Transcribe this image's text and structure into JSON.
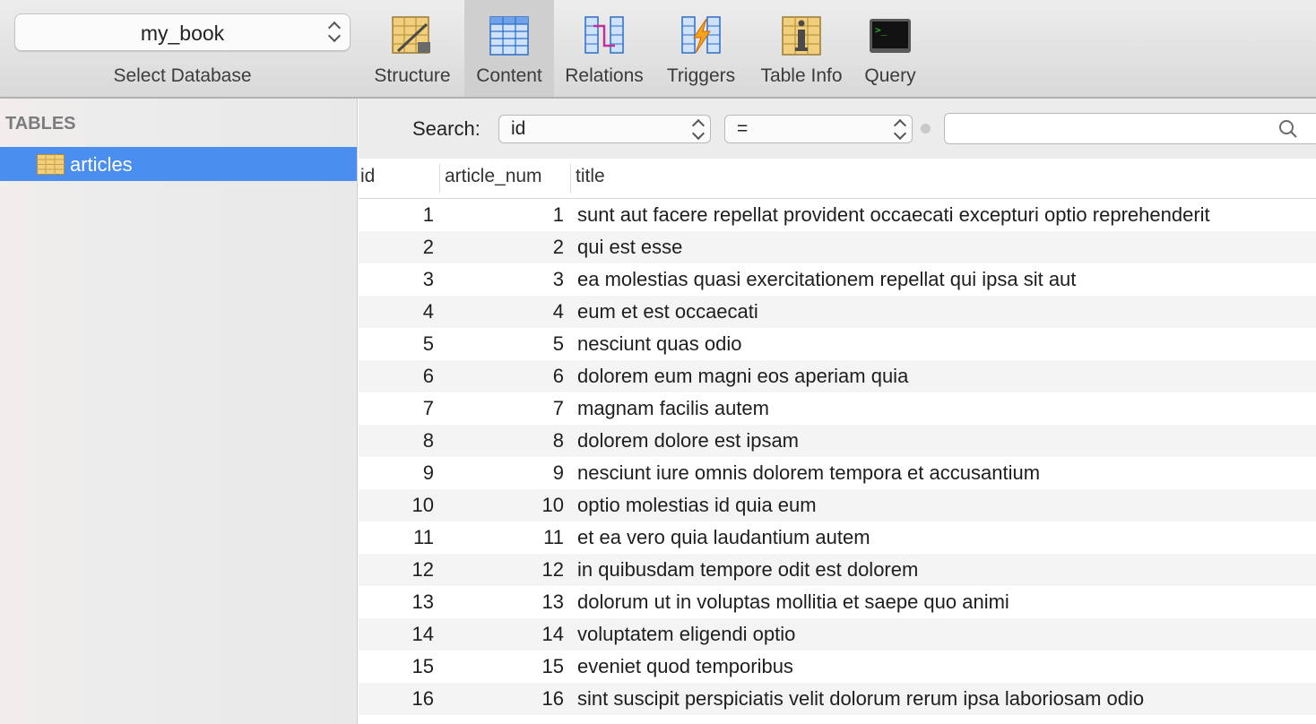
{
  "toolbar": {
    "database": {
      "selected": "my_book",
      "label": "Select Database"
    },
    "tools": [
      {
        "label": "Structure",
        "icon": "structure-icon"
      },
      {
        "label": "Content",
        "icon": "content-icon",
        "active": true
      },
      {
        "label": "Relations",
        "icon": "relations-icon"
      },
      {
        "label": "Triggers",
        "icon": "triggers-icon"
      },
      {
        "label": "Table Info",
        "icon": "table-info-icon"
      },
      {
        "label": "Query",
        "icon": "query-icon"
      }
    ]
  },
  "sidebar": {
    "heading": "TABLES",
    "tables": [
      {
        "name": "articles",
        "selected": true
      }
    ]
  },
  "filter": {
    "label": "Search:",
    "field": "id",
    "operator": "=",
    "value": ""
  },
  "table": {
    "columns": [
      "id",
      "article_num",
      "title"
    ],
    "rows": [
      [
        "1",
        "1",
        "sunt aut facere repellat provident occaecati excepturi optio reprehenderit"
      ],
      [
        "2",
        "2",
        "qui est esse"
      ],
      [
        "3",
        "3",
        "ea molestias quasi exercitationem repellat qui ipsa sit aut"
      ],
      [
        "4",
        "4",
        "eum et est occaecati"
      ],
      [
        "5",
        "5",
        "nesciunt quas odio"
      ],
      [
        "6",
        "6",
        "dolorem eum magni eos aperiam quia"
      ],
      [
        "7",
        "7",
        "magnam facilis autem"
      ],
      [
        "8",
        "8",
        "dolorem dolore est ipsam"
      ],
      [
        "9",
        "9",
        "nesciunt iure omnis dolorem tempora et accusantium"
      ],
      [
        "10",
        "10",
        "optio molestias id quia eum"
      ],
      [
        "11",
        "11",
        "et ea vero quia laudantium autem"
      ],
      [
        "12",
        "12",
        "in quibusdam tempore odit est dolorem"
      ],
      [
        "13",
        "13",
        "dolorum ut in voluptas mollitia et saepe quo animi"
      ],
      [
        "14",
        "14",
        "voluptatem eligendi optio"
      ],
      [
        "15",
        "15",
        "eveniet quod temporibus"
      ],
      [
        "16",
        "16",
        "sint suscipit perspiciatis velit dolorum rerum ipsa laboriosam odio"
      ]
    ]
  },
  "colors": {
    "selection": "#4a8ff0",
    "toolbar": "#e3e3e3",
    "stripe": "#f4f4f4"
  }
}
